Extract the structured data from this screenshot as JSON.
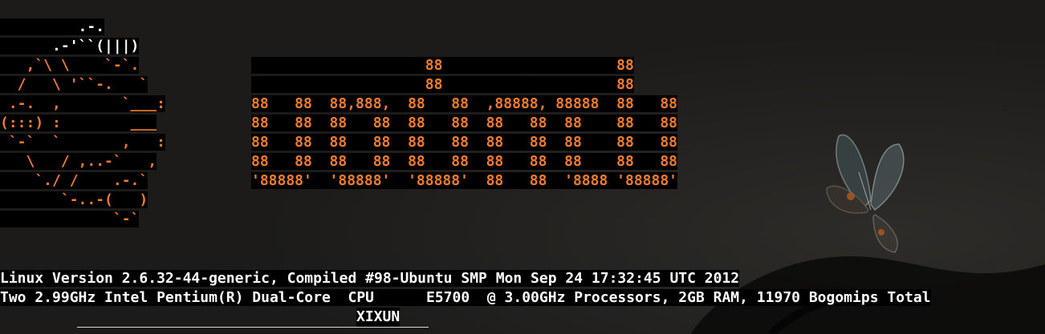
{
  "colors": {
    "logo_orange": "#f07b2a",
    "logo_white": "#ffffff",
    "terminal_background": "#000000",
    "info_text": "#ffffff",
    "wallpaper": "#1e1d1b"
  },
  "wallpaper": {
    "icon": "butterfly-icon"
  },
  "terminal": {
    "logo_lines": [
      {
        "white": "         .-.",
        "orange": ""
      },
      {
        "white": "      .-'``(|||)",
        "orange": ""
      },
      {
        "white": "",
        "orange": "   ,`\\ \\    `-`."
      },
      {
        "white": "",
        "orange": "  /   \\ '``-.   `"
      },
      {
        "white": "",
        "orange": " .-.  ,       `___:"
      },
      {
        "white": "",
        "orange": "(:::) :        ___"
      },
      {
        "white": "",
        "orange": " `-`  `       ,   :"
      },
      {
        "white": "",
        "orange": "   \\   / ,..-`   ,"
      },
      {
        "white": "",
        "orange": "    `./ /    .-.`"
      },
      {
        "white": "",
        "orange": "       `-..-(   )"
      },
      {
        "white": "",
        "orange": "             `-`"
      }
    ],
    "banner_lines": [
      "                    88                    88",
      "                    88                    88",
      "88   88  88,888,  88   88  ,88888, 88888  88   88",
      "88   88  88   88  88   88  88   88  88    88   88",
      "88   88  88   88  88   88  88   88  88    88   88",
      "88   88  88   88  88   88  88   88  88    88   88",
      "'88888'  '88888'  '88888'  88   88  '8888 '88888'"
    ],
    "info_lines": [
      "Linux Version 2.6.32-44-generic, Compiled #98-Ubuntu SMP Mon Sep 24 17:32:45 UTC 2012",
      "Two 2.99GHz Intel Pentium(R) Dual-Core  CPU      E5700  @ 3.00GHz Processors, 2GB RAM, 11970 Bogomips Total"
    ],
    "hostname": "XIXUN"
  }
}
